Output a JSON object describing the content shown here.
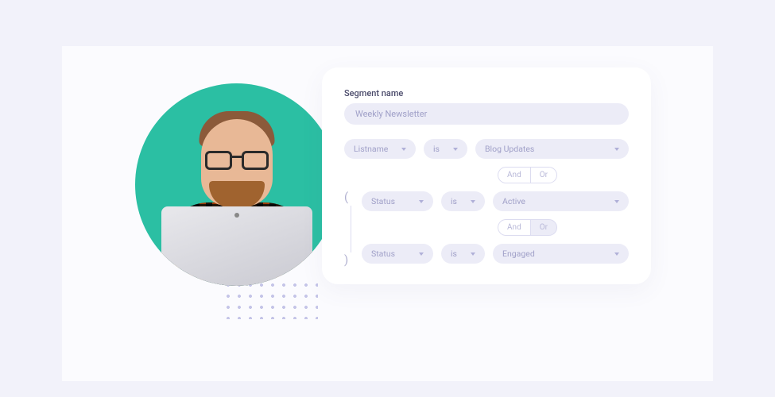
{
  "form": {
    "segment_label": "Segment name",
    "segment_value": "Weekly Newsletter",
    "rule1": {
      "field": "Listname",
      "op": "is",
      "value": "Blog Updates"
    },
    "logic1": {
      "and": "And",
      "or": "Or"
    },
    "group": {
      "open": "(",
      "close": ")",
      "rule2": {
        "field": "Status",
        "op": "is",
        "value": "Active"
      },
      "logic2": {
        "and": "And",
        "or": "Or"
      },
      "rule3": {
        "field": "Status",
        "op": "is",
        "value": "Engaged"
      }
    }
  }
}
